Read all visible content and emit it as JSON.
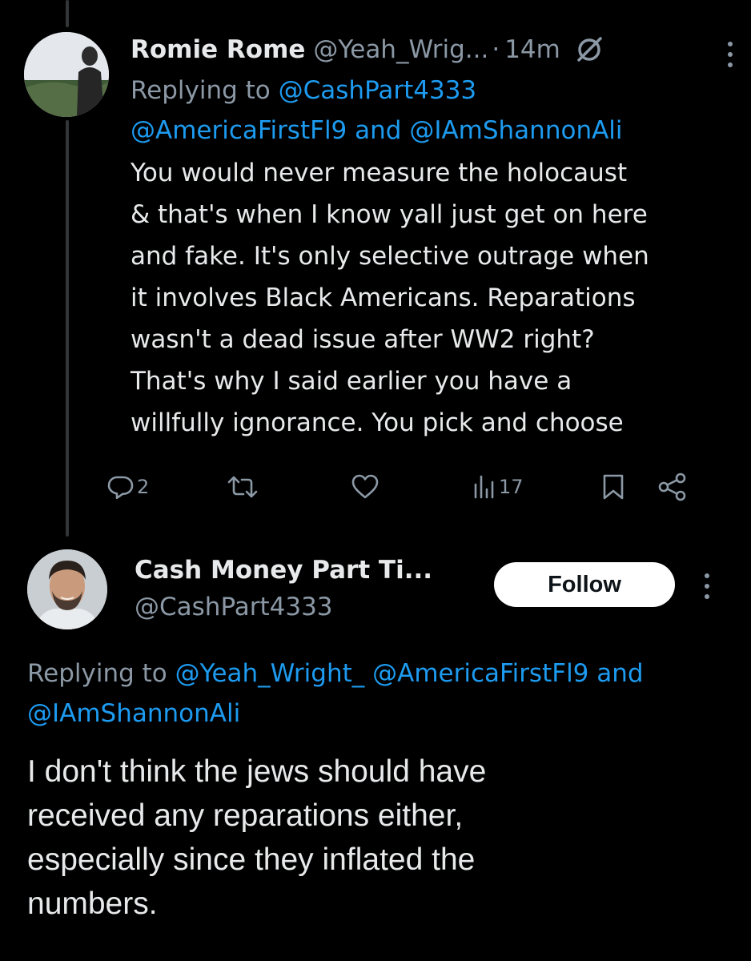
{
  "reply": {
    "author_name": "Romie Rome",
    "author_handle": "@Yeah_Wrig...",
    "separator": "·",
    "time": "14m",
    "replying_prefix": "Replying to ",
    "replying_mention_1": "@CashPart4333",
    "replying_mention_2": "@AmericaFirstFl9",
    "replying_and": " and ",
    "replying_mention_3": "@IAmShannonAli",
    "text_lines": [
      "You would never measure the holocaust",
      "& that's when I know yall just get on here",
      "and fake. It's only selective outrage when",
      "it involves Black Americans. Reparations",
      "wasn't a dead issue after WW2 right?",
      "That's why I said earlier you have a",
      "willfully ignorance. You pick and choose"
    ],
    "actions": {
      "reply_count": "2",
      "view_count": "17"
    },
    "icons": [
      "reply-icon",
      "retweet-icon",
      "like-icon",
      "views-icon",
      "bookmark-icon",
      "share-icon",
      "grok-icon",
      "more-icon"
    ]
  },
  "tweet": {
    "author_name": "Cash Money Part Ti...",
    "author_handle": "@CashPart4333",
    "follow_label": "Follow",
    "replying_prefix": "Replying to ",
    "replying_mention_1": "@Yeah_Wright_",
    "replying_mention_2": "@AmericaFirstFl9",
    "replying_and": " and",
    "replying_mention_3": "@IAmShannonAli",
    "text_lines": [
      "I don't think the jews should have",
      "received any reparations either,",
      "especially since they inflated the",
      "numbers."
    ]
  },
  "colors": {
    "background": "#000000",
    "text": "#e7e9ea",
    "secondary": "#8b98a5",
    "link": "#1d9bf0",
    "follow_bg": "#ffffff"
  }
}
